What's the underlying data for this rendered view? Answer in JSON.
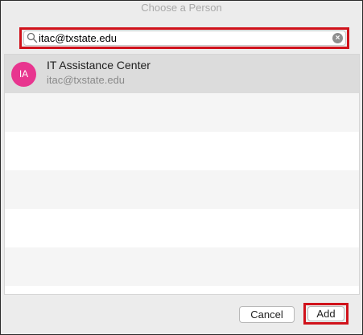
{
  "dialog": {
    "title": "Choose a Person"
  },
  "search": {
    "value": "itac@txstate.edu",
    "icon": "search-icon",
    "clear_icon": "clear-icon",
    "highlight_color": "#d0121b"
  },
  "results": [
    {
      "initials": "IA",
      "name": "IT Assistance Center",
      "email": "itac@txstate.edu",
      "avatar_color": "#e8358f",
      "selected": true
    }
  ],
  "buttons": {
    "cancel_label": "Cancel",
    "add_label": "Add"
  }
}
